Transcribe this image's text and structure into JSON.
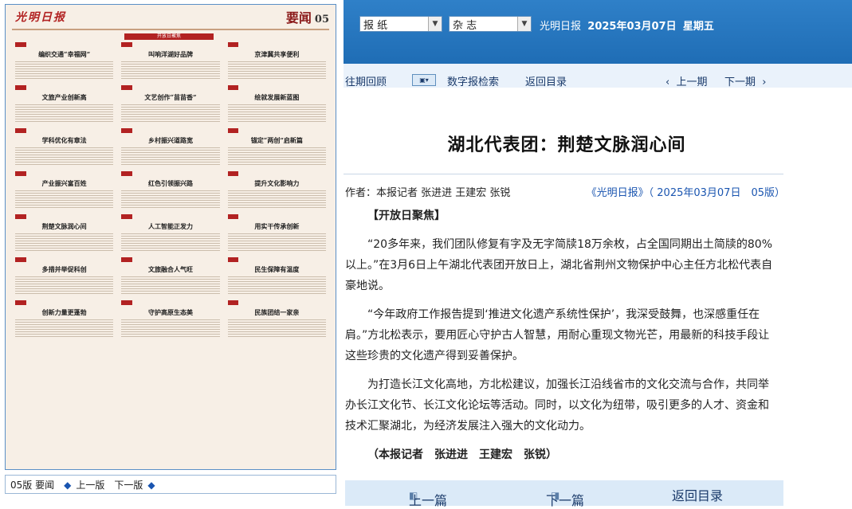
{
  "newspaper": {
    "logo": "光明日报",
    "section": "要闻",
    "page": "05",
    "feature_banner": "开放日聚焦",
    "cells": [
      {
        "title": "编织交通“幸福网”"
      },
      {
        "title": "叫响洋湖好品牌"
      },
      {
        "title": "京津冀共享便利"
      },
      {
        "title": "文旅产业创新高"
      },
      {
        "title": "文艺创作“苗苗香”"
      },
      {
        "title": "绘就发展新蓝图"
      },
      {
        "title": "学科优化有章法"
      },
      {
        "title": "乡村振兴道路宽"
      },
      {
        "title": "锚定“两创”启新篇"
      },
      {
        "title": "产业振兴富百姓"
      },
      {
        "title": "红色引领振兴路"
      },
      {
        "title": "提升文化影响力"
      },
      {
        "title": "荆楚文脉润心间"
      },
      {
        "title": "人工智能正发力"
      },
      {
        "title": "用实干传承创新"
      },
      {
        "title": "多措并举促科创"
      },
      {
        "title": "文旅融合人气旺"
      },
      {
        "title": "民生保障有温度"
      },
      {
        "title": "创新力量更蓬勃"
      },
      {
        "title": "守护高原生态美"
      },
      {
        "title": "民族团结一家亲"
      }
    ]
  },
  "left_pager": {
    "label": "05版 要闻",
    "prev": "上一版",
    "next": "下一版"
  },
  "top": {
    "select_paper": "报 纸",
    "select_magazine": "杂 志",
    "paper_name": "光明日报",
    "date": "2025年03月07日",
    "weekday": "星期五"
  },
  "nav": {
    "history": "往期回顾",
    "search": "数字报检索",
    "back": "返回目录",
    "prev_issue": "上一期",
    "next_issue": "下一期"
  },
  "article": {
    "title": "湖北代表团：荆楚文脉润心间",
    "byline": "作者：本报记者 张进进 王建宏 张锐",
    "source": "《光明日报》（ 2025年03月07日　05版）",
    "section": "【开放日聚焦】",
    "paragraphs": [
      "“20多年来，我们团队修复有字及无字简牍18万余枚，占全国同期出土简牍的80%以上。”在3月6日上午湖北代表团开放日上，湖北省荆州文物保护中心主任方北松代表自豪地说。",
      "“今年政府工作报告提到‘推进文化遗产系统性保护’，我深受鼓舞，也深感重任在肩。”方北松表示，要用匠心守护古人智慧，用耐心重现文物光芒，用最新的科技手段让这些珍贵的文化遗产得到妥善保护。",
      "为打造长江文化高地，方北松建议，加强长江沿线省市的文化交流与合作，共同举办长江文化节、长江文化论坛等活动。同时，以文化为纽带，吸引更多的人才、资金和技术汇聚湖北，为经济发展注入强大的文化动力。"
    ],
    "signature": "（本报记者　张进进　王建宏　张锐）"
  },
  "bottom": {
    "prev": "上一篇",
    "next": "下一篇",
    "back": "返回目录"
  }
}
